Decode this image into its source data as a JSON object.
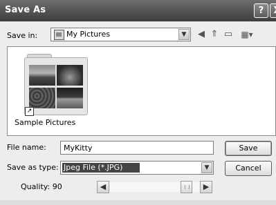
{
  "window": {
    "title": "Save As",
    "help_label": "?",
    "close_label": "X"
  },
  "save_in": {
    "label": "Save in:",
    "value": "My Pictures",
    "dropdown_icon": "chevron-down-icon",
    "folder_icon": "pictures-folder-icon"
  },
  "toolbar": {
    "back_icon": "back-arrow-icon",
    "up_icon": "up-folder-icon",
    "new_folder_icon": "new-folder-icon",
    "views_icon": "views-menu-icon"
  },
  "files": [
    {
      "name": "Sample Pictures",
      "icon": "shortcut-folder-icon"
    }
  ],
  "file_name": {
    "label": "File name:",
    "value": "MyKitty"
  },
  "save_as_type": {
    "label": "Save as type:",
    "value": "Jpeg File (*.JPG)"
  },
  "quality": {
    "label": "Quality: 90",
    "level_percent": 90
  },
  "buttons": {
    "save": "Save",
    "cancel": "Cancel"
  },
  "colors": {
    "titlebar": "#4a4a4a",
    "window_bg": "#ededed",
    "selection": "#444444"
  }
}
